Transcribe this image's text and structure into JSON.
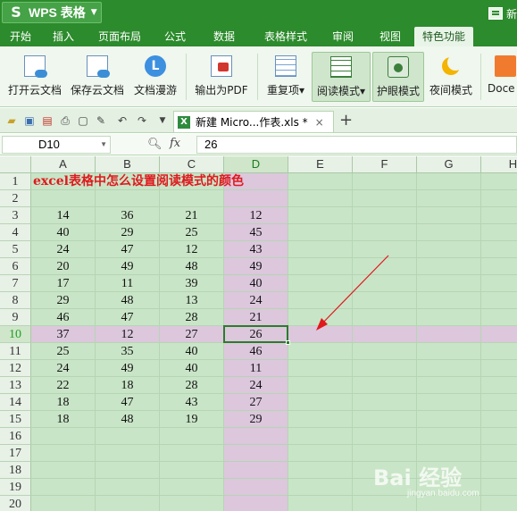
{
  "app": {
    "logo": "S",
    "name": "WPS 表格",
    "new_label": "新"
  },
  "menu": {
    "tabs": [
      {
        "label": "开始",
        "active": false
      },
      {
        "label": "插入",
        "active": false
      },
      {
        "label": "页面布局",
        "active": false
      },
      {
        "label": "公式",
        "active": false
      },
      {
        "label": "数据",
        "active": false
      },
      {
        "label": "表格样式",
        "active": false
      },
      {
        "label": "审阅",
        "active": false
      },
      {
        "label": "视图",
        "active": false
      },
      {
        "label": "特色功能",
        "active": true
      }
    ]
  },
  "ribbon": {
    "buttons": [
      {
        "label": "打开云文档",
        "icon": "open-cloud-doc-icon"
      },
      {
        "label": "保存云文档",
        "icon": "save-cloud-doc-icon"
      },
      {
        "label": "文档漫游",
        "icon": "doc-roaming-icon"
      },
      {
        "label": "输出为PDF",
        "icon": "export-pdf-icon"
      },
      {
        "label": "重复项",
        "icon": "duplicates-icon",
        "dropdown": "▾"
      },
      {
        "label": "阅读模式",
        "icon": "reading-mode-icon",
        "dropdown": "▾",
        "pressed": true
      },
      {
        "label": "护眼模式",
        "icon": "eye-protection-icon",
        "pressed": true
      },
      {
        "label": "夜间模式",
        "icon": "night-mode-icon"
      },
      {
        "label": "Doce",
        "icon": "docer-icon"
      }
    ]
  },
  "tabs_bar": {
    "doc_title": "新建 Micro...作表.xls *",
    "close": "×",
    "add": "+"
  },
  "formula_bar": {
    "cell_ref": "D10",
    "fx": "fx",
    "value": "26"
  },
  "sheet": {
    "columns": [
      "A",
      "B",
      "C",
      "D",
      "E",
      "F",
      "G",
      "H"
    ],
    "row_numbers": [
      "1",
      "2",
      "3",
      "4",
      "5",
      "6",
      "7",
      "8",
      "9",
      "10",
      "11",
      "12",
      "13",
      "14",
      "15",
      "16",
      "17",
      "18",
      "19",
      "20"
    ],
    "title_cell": "excel表格中怎么设置阅读模式的颜色",
    "data_rows": [
      [
        "14",
        "36",
        "21",
        "12"
      ],
      [
        "40",
        "29",
        "25",
        "45"
      ],
      [
        "24",
        "47",
        "12",
        "43"
      ],
      [
        "20",
        "49",
        "48",
        "49"
      ],
      [
        "17",
        "11",
        "39",
        "40"
      ],
      [
        "29",
        "48",
        "13",
        "24"
      ],
      [
        "46",
        "47",
        "28",
        "21"
      ],
      [
        "37",
        "12",
        "27",
        "26"
      ],
      [
        "25",
        "35",
        "40",
        "46"
      ],
      [
        "24",
        "49",
        "40",
        "11"
      ],
      [
        "22",
        "18",
        "28",
        "24"
      ],
      [
        "18",
        "47",
        "43",
        "27"
      ],
      [
        "18",
        "48",
        "19",
        "29"
      ]
    ],
    "active_cell": "D10",
    "active_row": "10",
    "active_col": "D"
  },
  "colors": {
    "title_bar": "#2c8b2c",
    "reading_mode_highlight": "#dcc7dd",
    "eye_protection_bg": "#c9e5c7",
    "title_text": "#e0191e",
    "arrow": "#e0191e"
  },
  "watermark": {
    "logo": "Bai 经验",
    "url": "jingyan.baidu.com"
  }
}
